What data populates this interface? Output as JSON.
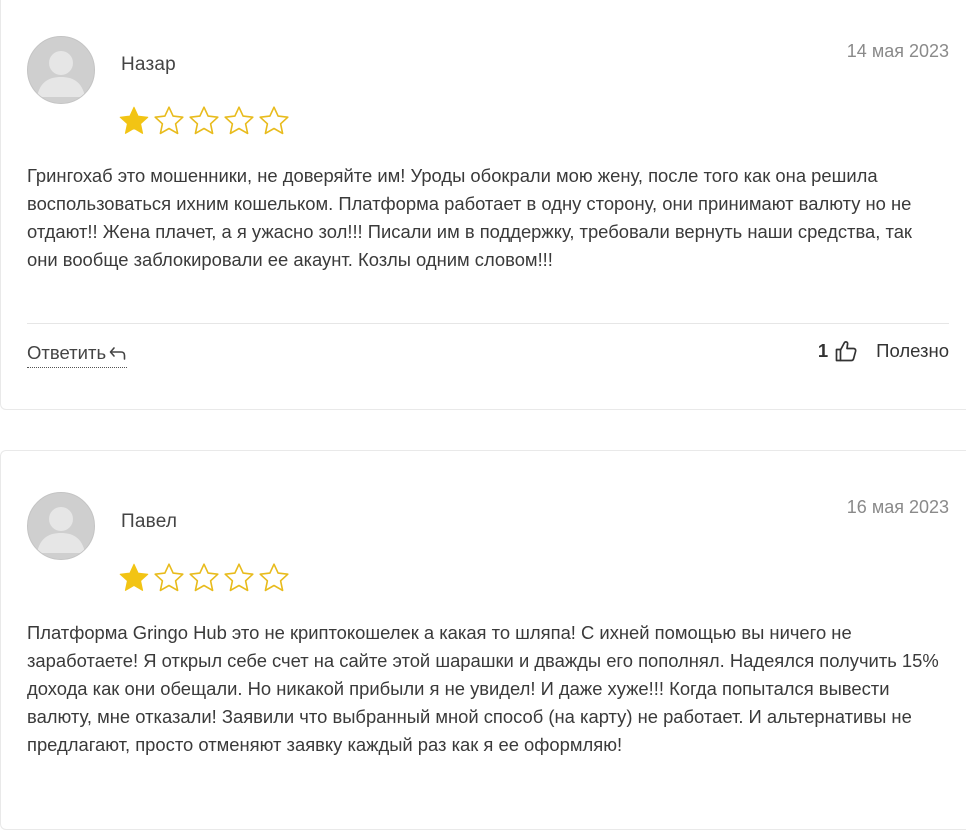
{
  "reviews": [
    {
      "author": "Назар",
      "date": "14 мая 2023",
      "rating": 1,
      "max_rating": 5,
      "text": "Грингохаб это мошенники, не доверяйте им! Уроды обокрали мою жену, после того как она решила воспользоваться ихним кошельком. Платформа работает в одну сторону, они принимают валюту но не отдают!! Жена плачет, а я ужасно зол!!! Писали им в поддержку, требовали вернуть наши средства, так они вообще заблокировали ее акаунт. Козлы одним словом!!!",
      "reply_label": "Ответить",
      "helpful_count": "1",
      "helpful_label": "Полезно"
    },
    {
      "author": "Павел",
      "date": "16 мая 2023",
      "rating": 1,
      "max_rating": 5,
      "text": "Платформа Gringo Hub это не криптокошелек а какая то шляпа! С ихней помощью вы ничего не заработаете! Я открыл себе счет на сайте этой шарашки и дважды его пополнял. Надеялся получить 15% дохода как они обещали. Но никакой прибыли я не увидел! И даже хуже!!! Когда попытался вывести валюту, мне отказали! Заявили что выбранный мной способ (на карту) не работает. И альтернативы не предлагают, просто отменяют заявку каждый раз как я ее оформляю!"
    }
  ],
  "colors": {
    "star_filled": "#f2c414",
    "star_outline": "#e8bb1c",
    "avatar_bg": "#cfcfcf",
    "avatar_figure": "#e3e3e3"
  },
  "icons": {
    "avatar": "user-silhouette-icon",
    "star_filled": "star-filled-icon",
    "star_empty": "star-outline-icon",
    "reply": "reply-arrow-icon",
    "helpful": "thumbs-up-icon"
  }
}
